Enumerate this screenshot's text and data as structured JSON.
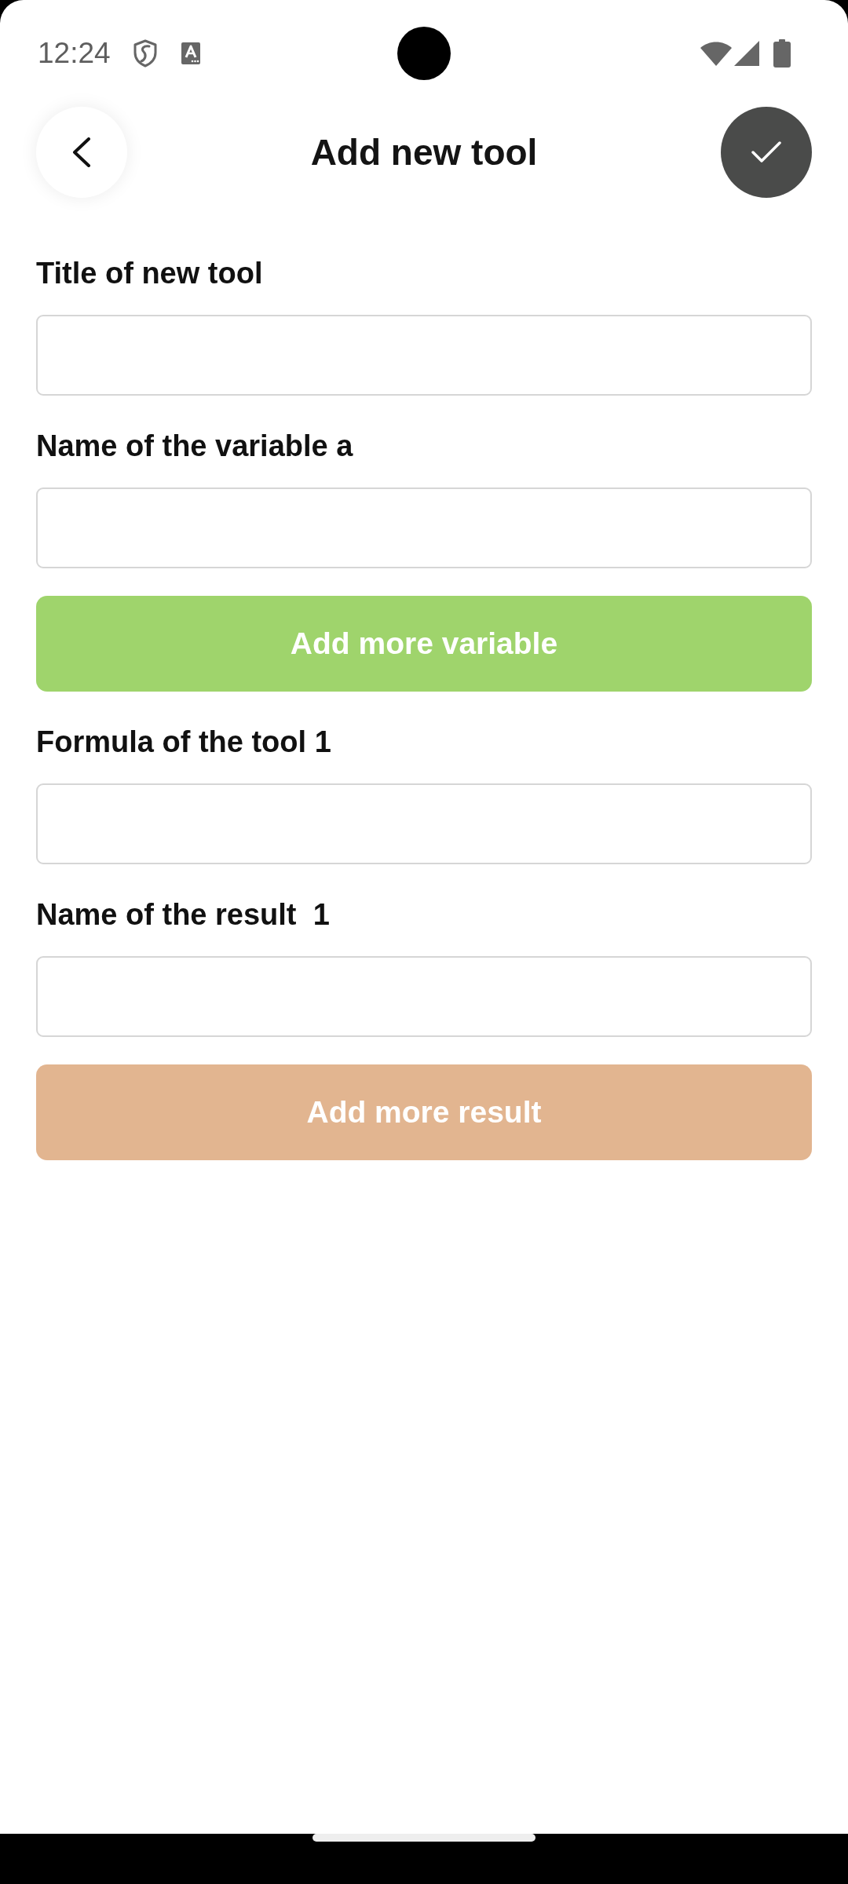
{
  "status_bar": {
    "time": "12:24"
  },
  "header": {
    "title": "Add new tool"
  },
  "form": [
    {
      "kind": "field",
      "label": "Title of new tool"
    },
    {
      "kind": "field",
      "label": "Name of the variable a"
    },
    {
      "kind": "button",
      "label": "Add more variable",
      "color": "#9fd46c"
    },
    {
      "kind": "field",
      "label": "Formula of the tool 1"
    },
    {
      "kind": "field",
      "label": "Name of the result  1"
    },
    {
      "kind": "button",
      "label": "Add more result",
      "color": "#e2b590"
    }
  ]
}
